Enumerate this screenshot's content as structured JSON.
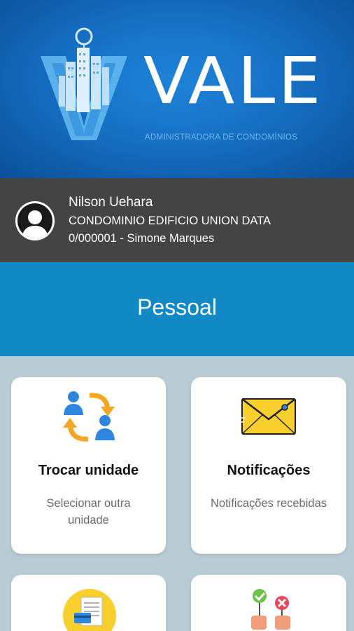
{
  "brand": {
    "name": "VALE",
    "subtitle": "ADMINISTRADORA DE CONDOMÍNIOS"
  },
  "user": {
    "name": "Nilson Uehara",
    "condominium": "CONDOMINIO EDIFICIO UNION DATA",
    "unit": "0/000001 - Simone Marques"
  },
  "section": {
    "title": "Pessoal"
  },
  "cards": [
    {
      "title": "Trocar unidade",
      "description": "Selecionar outra unidade",
      "icon": "swap-users-icon"
    },
    {
      "title": "Notificações",
      "description": "Notificações recebidas",
      "icon": "envelope-icon"
    },
    {
      "title": "",
      "description": "",
      "icon": "bill-payment-icon"
    },
    {
      "title": "",
      "description": "",
      "icon": "vote-approve-reject-icon"
    }
  ],
  "colors": {
    "header_blue": "#1670c4",
    "user_bar": "#444444",
    "section_blue": "#1289c4",
    "background": "#b9ccd6",
    "icon_orange": "#f5a623",
    "icon_blue": "#2e86de",
    "envelope_yellow": "#f9cf2d"
  }
}
